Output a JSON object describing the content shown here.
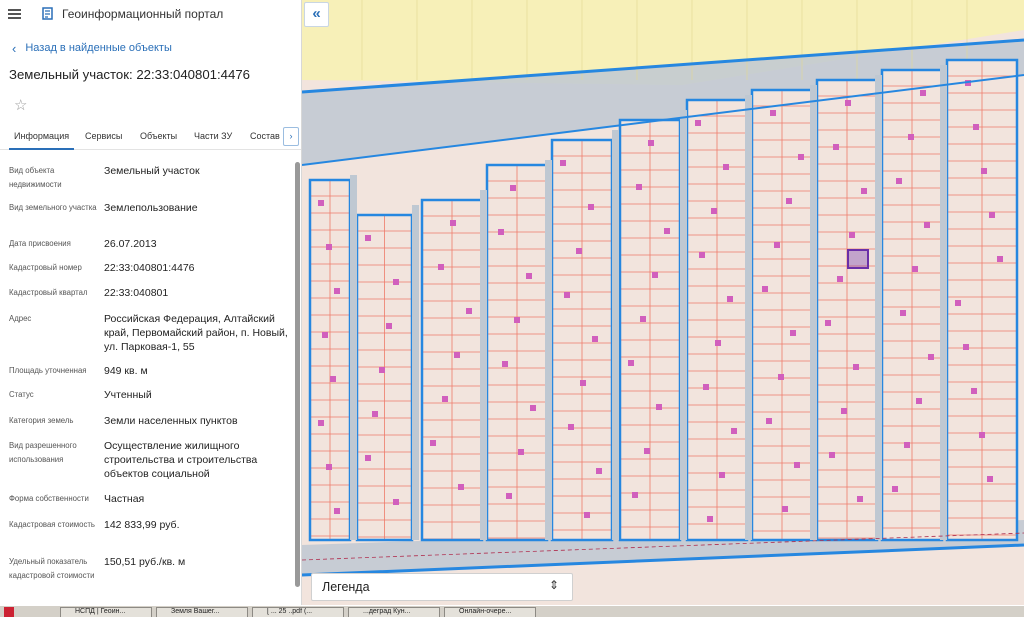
{
  "header": {
    "portal_title": "Геоинформационный портал"
  },
  "navigation": {
    "back_label": "Назад в найденные объекты"
  },
  "object": {
    "title": "Земельный участок: 22:33:040801:4476"
  },
  "tabs": [
    {
      "label": "Информация",
      "active": true
    },
    {
      "label": "Сервисы",
      "active": false
    },
    {
      "label": "Объекты",
      "active": false
    },
    {
      "label": "Части ЗУ",
      "active": false
    },
    {
      "label": "Состав",
      "active": false
    }
  ],
  "properties": [
    {
      "key": "Вид объекта недвижимости",
      "value": "Земельный участок"
    },
    {
      "key": "Вид земельного участка",
      "value": "Землепользование"
    },
    {
      "key": "Дата присвоения",
      "value": "26.07.2013"
    },
    {
      "key": "Кадастровый номер",
      "value": "22:33:040801:4476"
    },
    {
      "key": "Кадастровый квартал",
      "value": "22:33:040801"
    },
    {
      "key": "Адрес",
      "value": "Российская Федерация, Алтайский край, Первомайский район, п. Новый, ул. Парковая-1, 55"
    },
    {
      "key": "Площадь уточненная",
      "value": "949 кв. м"
    },
    {
      "key": "Статус",
      "value": "Учтенный"
    },
    {
      "key": "Категория земель",
      "value": "Земли населенных пунктов"
    },
    {
      "key": "Вид разрешенного использования",
      "value": "Осуществление жилищного строительства и строительства объектов социальной"
    },
    {
      "key": "Форма собственности",
      "value": "Частная"
    },
    {
      "key": "Кадастровая стоимость",
      "value": "142 833,99 руб."
    },
    {
      "key": "Удельный показатель кадастровой стоимости",
      "value": "150,51 руб./кв. м"
    }
  ],
  "map": {
    "legend_label": "Легенда",
    "colors": {
      "parcel_fill": "#f2e4dd",
      "parcel_line": "#ee7a6a",
      "block_border": "#2687e0",
      "road_fill": "#bfc8d2",
      "zone_yellow": "#f7f0b8",
      "building": "#d15fbd",
      "selected": "#6a2fa8"
    }
  },
  "icons": {
    "menu": "hamburger-icon",
    "logo": "portal-logo-icon",
    "back": "chevron-left-icon",
    "favorite": "star-icon",
    "tabs_more": "chevron-right-icon",
    "collapse": "double-chevron-left-icon",
    "legend_toggle": "sort-arrows-icon"
  },
  "taskbar": {
    "items": [
      "НСПД | Геоин...",
      "Земля Вашег...",
      "[ ... 25 ..pdf (...",
      "...деград Кун...",
      "Онлайн-очере..."
    ]
  }
}
